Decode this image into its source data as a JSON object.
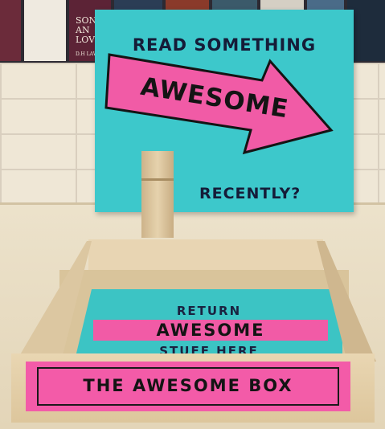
{
  "poster": {
    "book_lines": [
      "SON",
      "AN",
      "LOVI"
    ],
    "book_author": "D.H LAW"
  },
  "sign": {
    "top_text": "READ SOMETHING",
    "arrow_text": "AWESOME",
    "bottom_text": "RECENTLY?"
  },
  "card": {
    "line1": "RETURN",
    "line2": "AWESOME",
    "line3": "STUFF HERE"
  },
  "box_label": "THE AWESOME BOX",
  "colors": {
    "teal": "#3dc8cb",
    "pink": "#f15ba6",
    "ink": "#151c38",
    "wood": "#e6d2ad"
  }
}
